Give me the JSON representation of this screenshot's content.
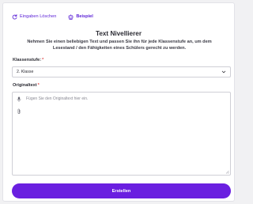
{
  "toolbar": {
    "clear_label": "Eingaben Löschen",
    "clear_icon": "refresh-icon",
    "example_label": "Beispiel",
    "example_icon": "bot-icon"
  },
  "header": {
    "title": "Text Nivellierer",
    "subtitle": "Nehmen Sie einen beliebigen Text und passen Sie ihn für jede Klassenstufe an, um dem Lesestand / den Fähigkeiten eines Schülers gerecht zu werden."
  },
  "form": {
    "grade_label": "Klassenstufe:",
    "grade_value": "2. Klasse",
    "text_label": "Originaltext",
    "required_mark": "*",
    "text_placeholder": "Fügen Sie den Originaltext hier ein.",
    "mic_icon": "microphone-icon",
    "attach_icon": "paperclip-icon"
  },
  "actions": {
    "submit_label": "Erstellen"
  },
  "colors": {
    "accent": "#6a1fe0",
    "link": "#5b21d6",
    "required": "#e04a4a"
  }
}
